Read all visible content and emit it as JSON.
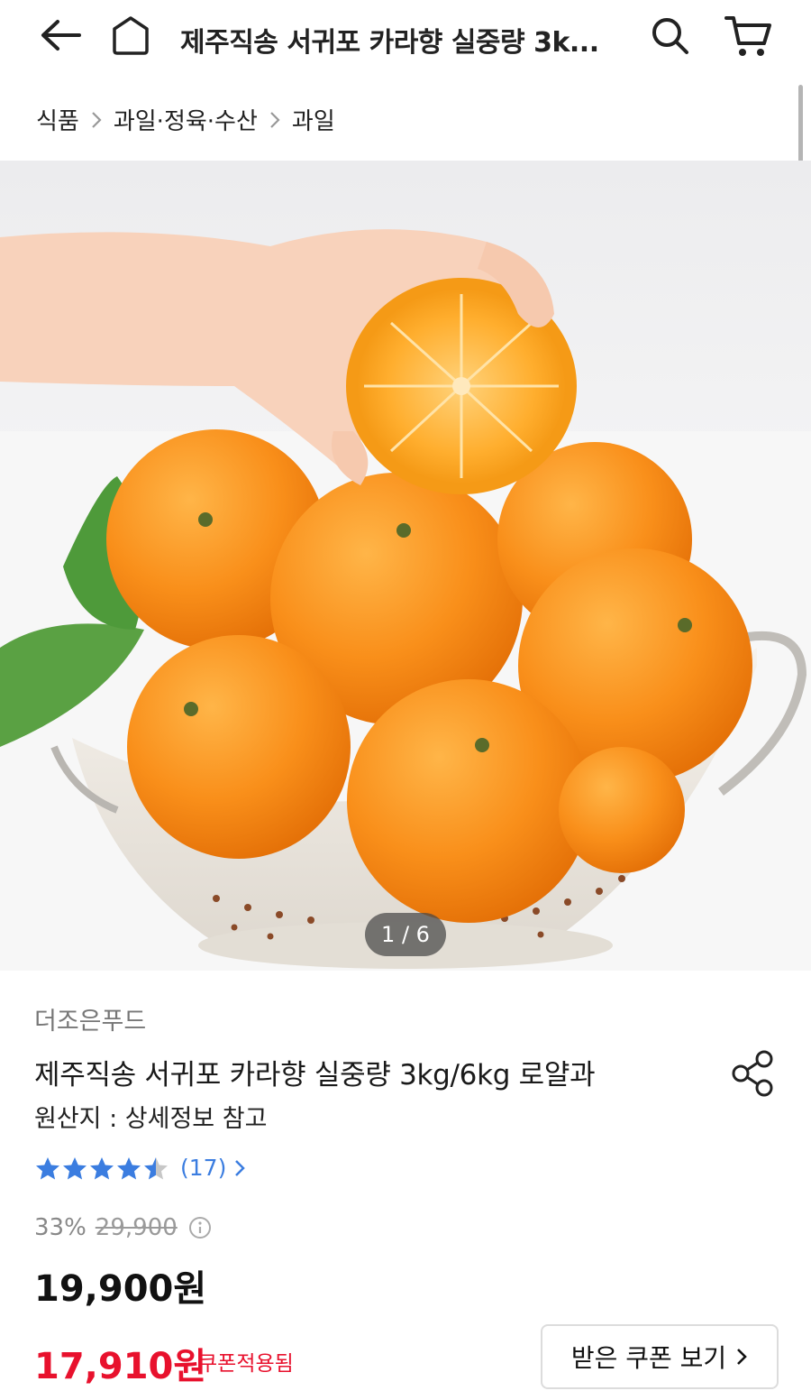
{
  "header": {
    "title": "제주직송 서귀포 카라향 실중량 3k...",
    "icons": [
      "back-arrow-icon",
      "home-icon",
      "search-icon",
      "cart-icon"
    ]
  },
  "breadcrumb": [
    "식품",
    "과일·정육·수산",
    "과일"
  ],
  "gallery": {
    "pager": "1 / 6"
  },
  "product": {
    "seller": "더조은푸드",
    "title": "제주직송 서귀포 카라향 실중량 3kg/6kg 로얄과",
    "origin": "원산지 : 상세정보 참고",
    "rating": 4.5,
    "review_count": "(17)",
    "discount": "33%",
    "original_price": "29,900",
    "price": "19,900원",
    "coupon_price": "17,910원",
    "coupon_tag": "쿠폰적용됨",
    "coupon_button": "받은 쿠폰 보기"
  },
  "colors": {
    "accent_red": "#e8112d",
    "star_blue": "#3b7de0",
    "star_gray": "#c7c7c7"
  }
}
